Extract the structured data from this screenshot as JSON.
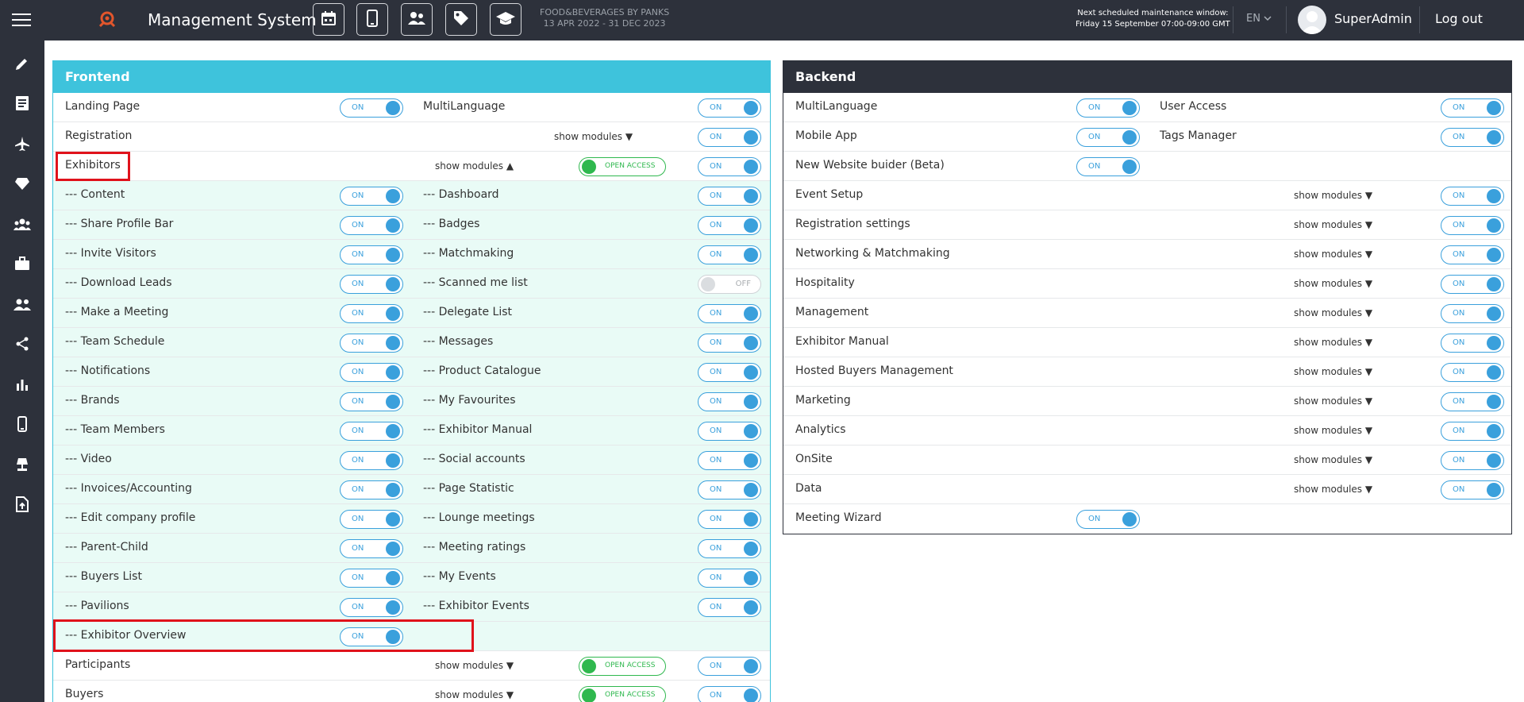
{
  "header": {
    "app_title": "Management System",
    "event_name": "FOOD&BEVERAGES BY PANKS",
    "event_dates": "13 APR 2022 - 31 DEC 2023",
    "maintenance_line1": "Next scheduled maintenance window:",
    "maintenance_line2": "Friday 15 September 07:00-09:00 GMT",
    "language": "EN",
    "user_name": "SuperAdmin",
    "logout_label": "Log out",
    "toolbar_icons": [
      "calendar-icon",
      "mobile-icon",
      "users-card-icon",
      "tag-icon",
      "graduation-cap-icon"
    ]
  },
  "sidebar": {
    "icons": [
      "pencil-icon",
      "list-icon",
      "plane-icon",
      "diamond-icon",
      "group-icon",
      "briefcase-icon",
      "people-icon",
      "share-icon",
      "bar-chart-icon",
      "mobile-icon",
      "lamp-icon",
      "file-upload-icon"
    ]
  },
  "frontend": {
    "title": "Frontend",
    "on_label": "ON",
    "off_label": "OFF",
    "show_modules_up": "show modules ▲",
    "show_modules_down": "show modules ▼",
    "open_access_label": "OPEN ACCESS",
    "landing_page": "Landing Page",
    "multilanguage": "MultiLanguage",
    "registration": "Registration",
    "exhibitors": "Exhibitors",
    "exhibitor_modules_left": [
      "--- Content",
      "--- Share Profile Bar",
      "--- Invite Visitors",
      "--- Download Leads",
      "--- Make a Meeting",
      "--- Team Schedule",
      "--- Notifications",
      "--- Brands",
      "--- Team Members",
      "--- Video",
      "--- Invoices/Accounting",
      "--- Edit company profile",
      "--- Parent-Child",
      "--- Buyers List",
      "--- Pavilions",
      "--- Exhibitor Overview"
    ],
    "exhibitor_modules_right": [
      "--- Dashboard",
      "--- Badges",
      "--- Matchmaking",
      "--- Scanned me list",
      "--- Delegate List",
      "--- Messages",
      "--- Product Catalogue",
      "--- My Favourites",
      "--- Exhibitor Manual",
      "--- Social accounts",
      "--- Page Statistic",
      "--- Lounge meetings",
      "--- Meeting ratings",
      "--- My Events",
      "--- Exhibitor Events"
    ],
    "participants": "Participants",
    "buyers": "Buyers"
  },
  "backend": {
    "title": "Backend",
    "on_label": "ON",
    "show_modules_down": "show modules ▼",
    "top_left": [
      "MultiLanguage",
      "Mobile App",
      "New Website buider (Beta)"
    ],
    "top_right": [
      "User Access",
      "Tags Manager"
    ],
    "module_rows": [
      "Event Setup",
      "Registration settings",
      "Networking & Matchmaking",
      "Hospitality",
      "Management",
      "Exhibitor Manual",
      "Hosted Buyers Management",
      "Marketing",
      "Analytics",
      "OnSite",
      "Data"
    ],
    "meeting_wizard": "Meeting Wizard"
  }
}
